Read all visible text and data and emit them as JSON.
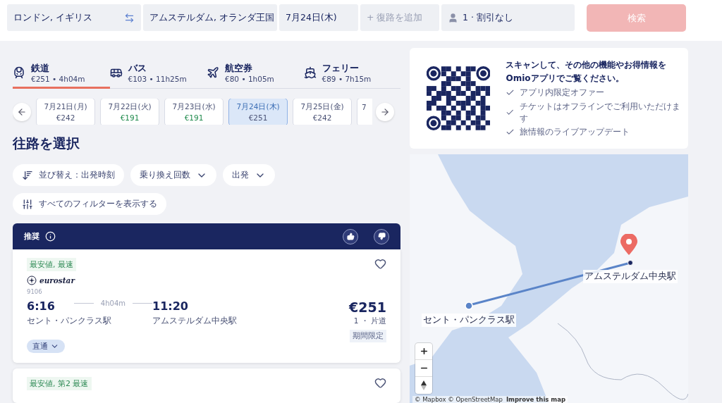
{
  "search_bar": {
    "origin": "ロンドン, イギリス",
    "destination": "アムステルダム, オランダ王国",
    "date": "7月24日(木)",
    "return_placeholder": "+ 復路を追加",
    "passengers": "1 · 割引なし",
    "search_button": "検索"
  },
  "modes": [
    {
      "kind": "train",
      "label": "鉄道",
      "summary": "€251 • 4h04m",
      "selected": true
    },
    {
      "kind": "bus",
      "label": "バス",
      "summary": "€103 • 11h25m",
      "selected": false
    },
    {
      "kind": "plane",
      "label": "航空券",
      "summary": "€80 • 1h05m",
      "selected": false
    },
    {
      "kind": "ferry",
      "label": "フェリー",
      "summary": "€89 • 7h15m",
      "selected": false
    }
  ],
  "dates": [
    {
      "label": "7月21日(月)",
      "price": "€242",
      "cheapest": false,
      "selected": false
    },
    {
      "label": "7月22日(火)",
      "price": "€191",
      "cheapest": true,
      "selected": false
    },
    {
      "label": "7月23日(水)",
      "price": "€191",
      "cheapest": true,
      "selected": false
    },
    {
      "label": "7月24日(木)",
      "price": "€251",
      "cheapest": false,
      "selected": true
    },
    {
      "label": "7月25日(金)",
      "price": "€242",
      "cheapest": false,
      "selected": false
    },
    {
      "label": "7"
    }
  ],
  "heading": "往路を選択",
  "filters": [
    {
      "kind": "sort",
      "label": "並び替え：出発時刻"
    },
    {
      "kind": "dropdown",
      "label": "乗り換え回数"
    },
    {
      "kind": "dropdown",
      "label": "出発"
    },
    {
      "kind": "all",
      "label": "すべてのフィルターを表示する"
    }
  ],
  "results": {
    "header": "推奨",
    "cards": [
      {
        "tag": "最安値, 最速",
        "operator": "eurostar",
        "train": "9106",
        "dep_time": "6:16",
        "duration": "4h04m",
        "arr_time": "11:20",
        "dep_station": "セント・パンクラス駅",
        "arr_station": "アムステルダム中央駅",
        "price": "€251",
        "fare": "1 ・ 片道",
        "badge": "期間限定",
        "stops": "直通"
      },
      {
        "tag": "最安値, 第2 最速"
      }
    ]
  },
  "promo": {
    "title": "スキャンして、その他の機能やお得情報をOmioアプリでご覧ください。",
    "features": [
      "アプリ内限定オファー",
      "チケットはオフラインでご利用いただけます",
      "旅情報のライブアップデート"
    ]
  },
  "map": {
    "origin_label": "セント・パンクラス駅",
    "destination_label": "アムステルダム中央駅",
    "attribution": "© Mapbox © OpenStreetMap",
    "improve_link": "Improve this map"
  }
}
